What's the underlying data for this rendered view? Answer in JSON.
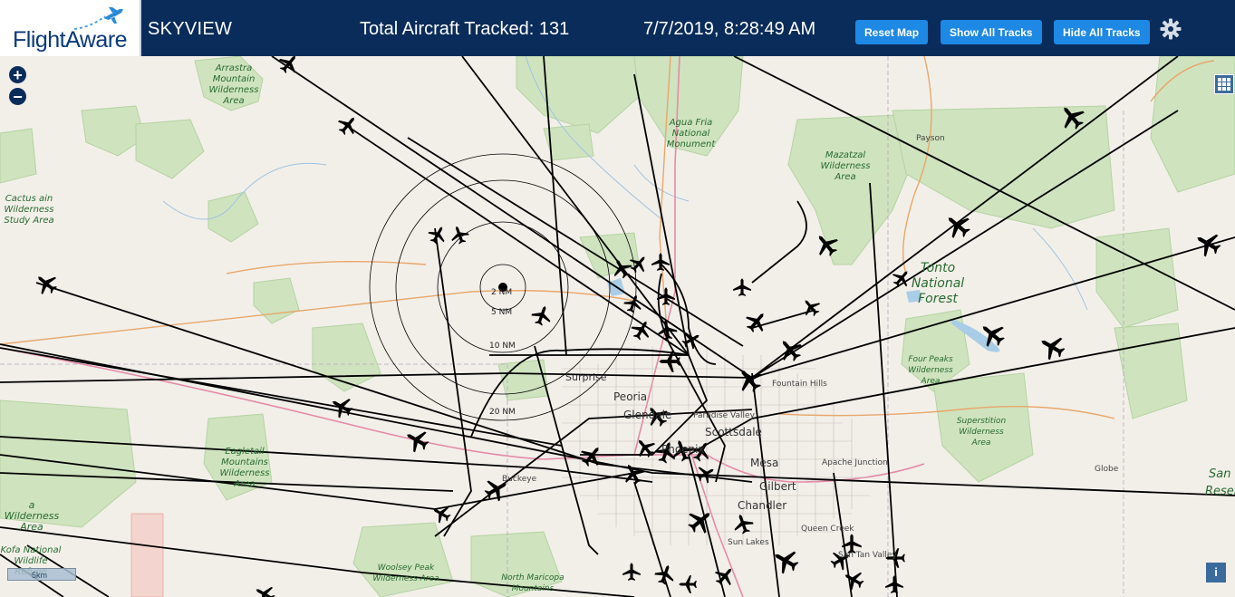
{
  "header": {
    "logo_text": "FlightAware",
    "app_title": "SKYVIEW",
    "aircraft_tracked": "Total Aircraft Tracked: 131",
    "datetime": "7/7/2019, 8:28:49 AM",
    "reset_map_label": "Reset Map",
    "show_tracks_label": "Show All Tracks",
    "hide_tracks_label": "Hide All Tracks",
    "settings_icon": "gear-icon"
  },
  "map_controls": {
    "zoom_in": "+",
    "zoom_out": "−",
    "layers_icon": "layers-grid-icon",
    "info_label": "i",
    "scale_text": "5km"
  },
  "range_rings": [
    "2 NM",
    "5 NM",
    "10 NM",
    "20 NM"
  ],
  "places": {
    "cities": [
      "Surprise",
      "Peoria",
      "Glendale",
      "Paradise Valley",
      "Scottsdale",
      "Phoenix",
      "Mesa",
      "Gilbert",
      "Chandler",
      "Fountain Hills",
      "Apache Junction",
      "Queen Creek",
      "Sun Lakes",
      "San Tan Valley",
      "Buckeye",
      "Payson",
      "Globe",
      "San",
      "Resen"
    ],
    "areas": {
      "arrastra": "Arrastra Mountain Wilderness Area",
      "agua_fria": "Agua Fria National Monument",
      "mazatzal": "Mazatzal Wilderness Area",
      "cactus": "Cactus ain Wilderness Study Area",
      "eagletail": "Eagletail Mountains Wilderness Area",
      "four_peaks": "Four Peaks Wilderness Area",
      "superstition": "Superstition Wilderness Area",
      "woolsey": "Woolsey Peak Wilderness Area",
      "north_maricopa": "North Maricopa Mountains",
      "wilderness_left": "a Wilderness Area",
      "refuge": "Kofa National Wildlife Refuge"
    },
    "forest": "Tonto National Forest"
  },
  "colors": {
    "header_bg": "#0a2c5a",
    "button_bg": "#1e88e5",
    "map_bg": "#f2efe9",
    "park_green": "#cde3c0",
    "water": "#a9cde6",
    "track": "#000000"
  }
}
